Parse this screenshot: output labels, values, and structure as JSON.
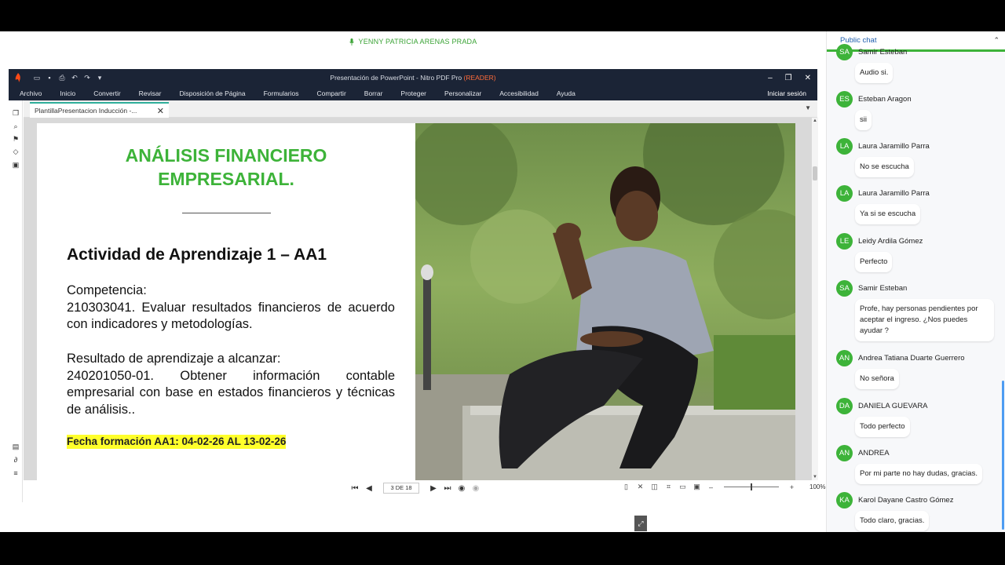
{
  "presenter": {
    "name": "YENNY PATRICIA ARENAS PRADA"
  },
  "window": {
    "title": "Presentación de PowerPoint - Nitro PDF Pro",
    "mode": "(READER)",
    "menu": [
      "Archivo",
      "Inicio",
      "Convertir",
      "Revisar",
      "Disposición de Página",
      "Formularios",
      "Compartir",
      "Borrar",
      "Proteger",
      "Personalizar",
      "Accesibilidad",
      "Ayuda"
    ],
    "login": "Iniciar sesión",
    "tab": "PlantillaPresentacion Inducción -..."
  },
  "slide": {
    "title_line1": "ANÁLISIS FINANCIERO",
    "title_line2": "EMPRESARIAL.",
    "activity": "Actividad de Aprendizaje 1 – AA1",
    "competencia_label": "Competencia:",
    "competencia_text": "210303041. Evaluar resultados financieros de acuerdo con indicadores y metodologías.",
    "resultado_label": "Resultado de aprendizaje a alcanzar:",
    "resultado_text": "240201050-01. Obtener información contable empresarial con base en estados financieros y técnicas de análisis..",
    "fecha": "Fecha formación AA1:  04-02-26 AL 13-02-26",
    "colors": {
      "title": "#3db339",
      "highlight": "#ffff2b"
    }
  },
  "status": {
    "page": "3 DE 18",
    "zoom": "100%"
  },
  "chat": {
    "header": "Public chat",
    "accent": "#3db339",
    "messages": [
      {
        "initials": "SA",
        "name": "Samir Esteban",
        "text": "Audio si."
      },
      {
        "initials": "ES",
        "name": "Esteban Aragon",
        "text": "sii"
      },
      {
        "initials": "LA",
        "name": "Laura Jaramillo Parra",
        "text": "No se escucha"
      },
      {
        "initials": "LA",
        "name": "Laura Jaramillo Parra",
        "text": "Ya si se escucha"
      },
      {
        "initials": "LE",
        "name": "Leidy Ardila Gómez",
        "text": "Perfecto"
      },
      {
        "initials": "SA",
        "name": "Samir Esteban",
        "text": "Profe, hay personas pendientes por aceptar el ingreso. ¿Nos puedes ayudar ?"
      },
      {
        "initials": "AN",
        "name": "Andrea Tatiana Duarte Guerrero",
        "text": "No señora"
      },
      {
        "initials": "DA",
        "name": "DANIELA GUEVARA",
        "text": "Todo perfecto"
      },
      {
        "initials": "AN",
        "name": "ANDREA",
        "text": "Por mi parte no hay dudas, gracias."
      },
      {
        "initials": "KA",
        "name": "Karol Dayane Castro Gómez",
        "text": "Todo claro, gracias."
      }
    ]
  }
}
